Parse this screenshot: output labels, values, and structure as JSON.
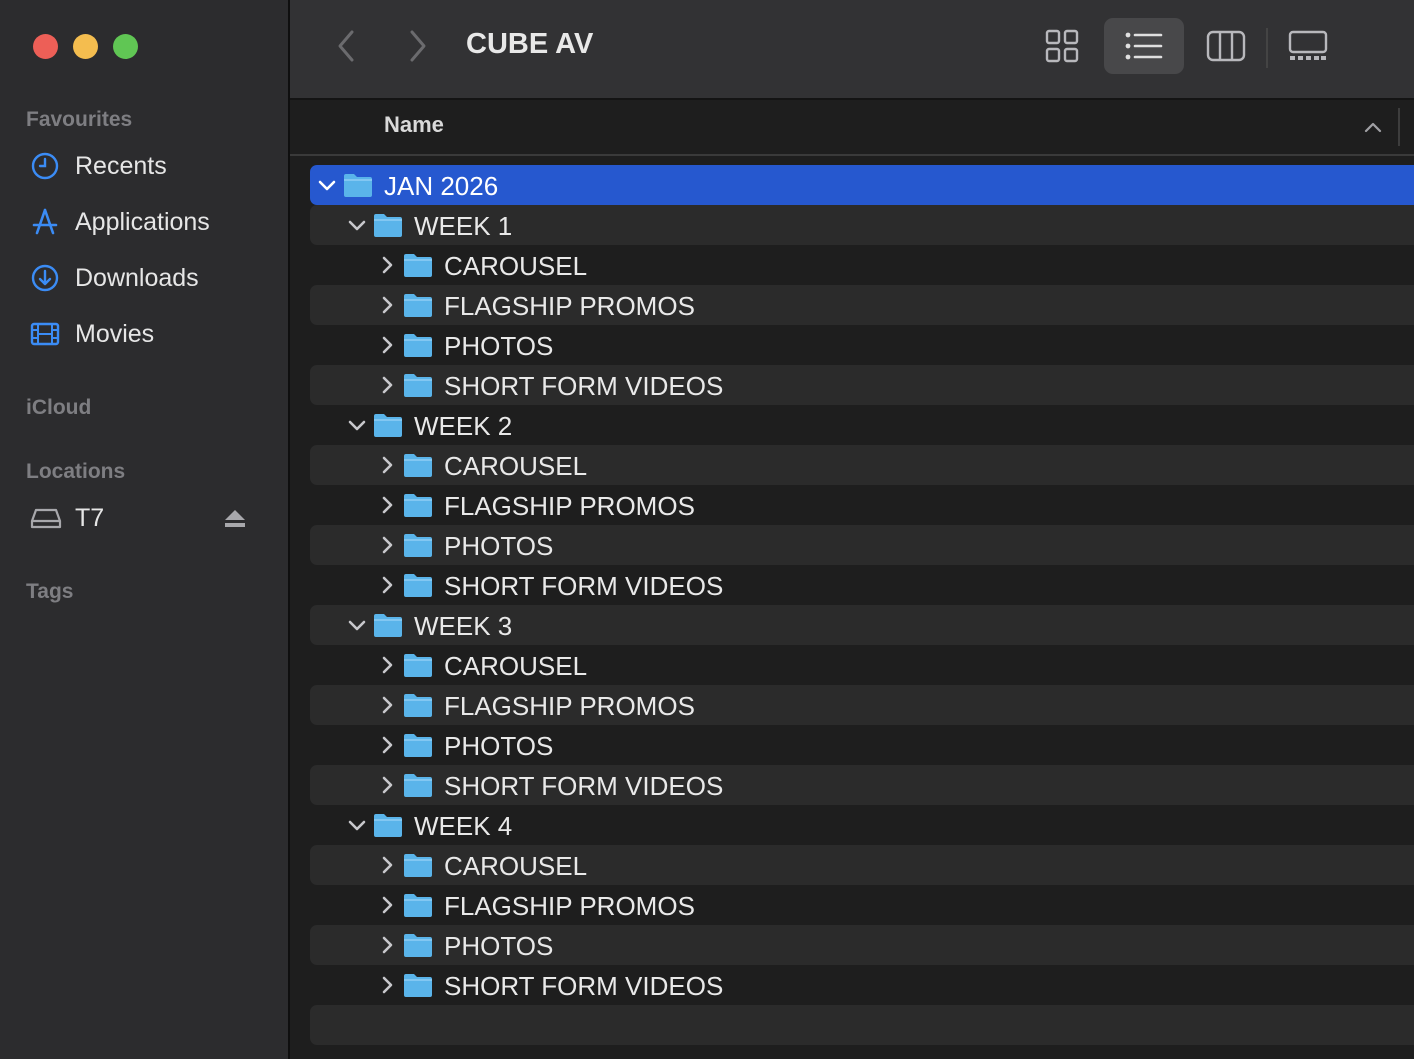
{
  "window": {
    "title": "CUBE AV"
  },
  "colors": {
    "accent": "#2658cf",
    "folder": "#5ab4ea",
    "sidebar_icon": "#3b8cf5"
  },
  "sidebar": {
    "favourites_label": "Favourites",
    "favourites": [
      {
        "label": "Recents",
        "icon": "clock-icon"
      },
      {
        "label": "Applications",
        "icon": "applications-icon"
      },
      {
        "label": "Downloads",
        "icon": "download-icon"
      },
      {
        "label": "Movies",
        "icon": "film-icon"
      }
    ],
    "icloud_label": "iCloud",
    "locations_label": "Locations",
    "locations": [
      {
        "label": "T7",
        "icon": "drive-icon"
      }
    ],
    "tags_label": "Tags"
  },
  "list_header": {
    "name_label": "Name"
  },
  "rows": [
    {
      "label": "JAN 2026",
      "level": 0,
      "expanded": true
    },
    {
      "label": "WEEK 1",
      "level": 1,
      "expanded": true
    },
    {
      "label": "CAROUSEL",
      "level": 2,
      "expanded": false
    },
    {
      "label": "FLAGSHIP PROMOS",
      "level": 2,
      "expanded": false
    },
    {
      "label": "PHOTOS",
      "level": 2,
      "expanded": false
    },
    {
      "label": "SHORT FORM VIDEOS",
      "level": 2,
      "expanded": false
    },
    {
      "label": "WEEK 2",
      "level": 1,
      "expanded": true
    },
    {
      "label": "CAROUSEL",
      "level": 2,
      "expanded": false
    },
    {
      "label": "FLAGSHIP PROMOS",
      "level": 2,
      "expanded": false
    },
    {
      "label": "PHOTOS",
      "level": 2,
      "expanded": false
    },
    {
      "label": "SHORT FORM VIDEOS",
      "level": 2,
      "expanded": false
    },
    {
      "label": "WEEK 3",
      "level": 1,
      "expanded": true
    },
    {
      "label": "CAROUSEL",
      "level": 2,
      "expanded": false
    },
    {
      "label": "FLAGSHIP PROMOS",
      "level": 2,
      "expanded": false
    },
    {
      "label": "PHOTOS",
      "level": 2,
      "expanded": false
    },
    {
      "label": "SHORT FORM VIDEOS",
      "level": 2,
      "expanded": false
    },
    {
      "label": "WEEK 4",
      "level": 1,
      "expanded": true
    },
    {
      "label": "CAROUSEL",
      "level": 2,
      "expanded": false
    },
    {
      "label": "FLAGSHIP PROMOS",
      "level": 2,
      "expanded": false
    },
    {
      "label": "PHOTOS",
      "level": 2,
      "expanded": false
    },
    {
      "label": "SHORT FORM VIDEOS",
      "level": 2,
      "expanded": false
    }
  ],
  "selected_row": 0
}
